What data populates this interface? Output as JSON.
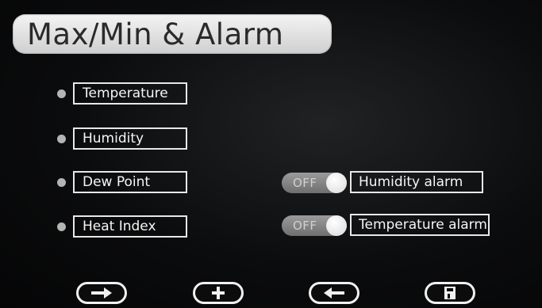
{
  "header": {
    "title": "Max/Min & Alarm"
  },
  "items": [
    {
      "label": "Temperature"
    },
    {
      "label": "Humidity"
    },
    {
      "label": "Dew Point"
    },
    {
      "label": "Heat Index"
    }
  ],
  "alarms": [
    {
      "toggle_state": "OFF",
      "label": "Humidity alarm"
    },
    {
      "toggle_state": "OFF",
      "label": "Temperature alarm"
    }
  ],
  "footer": {
    "buttons": [
      {
        "icon": "arrow-right-icon"
      },
      {
        "icon": "plus-icon"
      },
      {
        "icon": "arrow-left-icon"
      },
      {
        "icon": "save-icon"
      }
    ]
  },
  "colors": {
    "background": "#0b0c0d",
    "title_pill": "#e6e6e6",
    "toggle_off": "#8a8a8a",
    "outline": "#e8e8e8"
  }
}
